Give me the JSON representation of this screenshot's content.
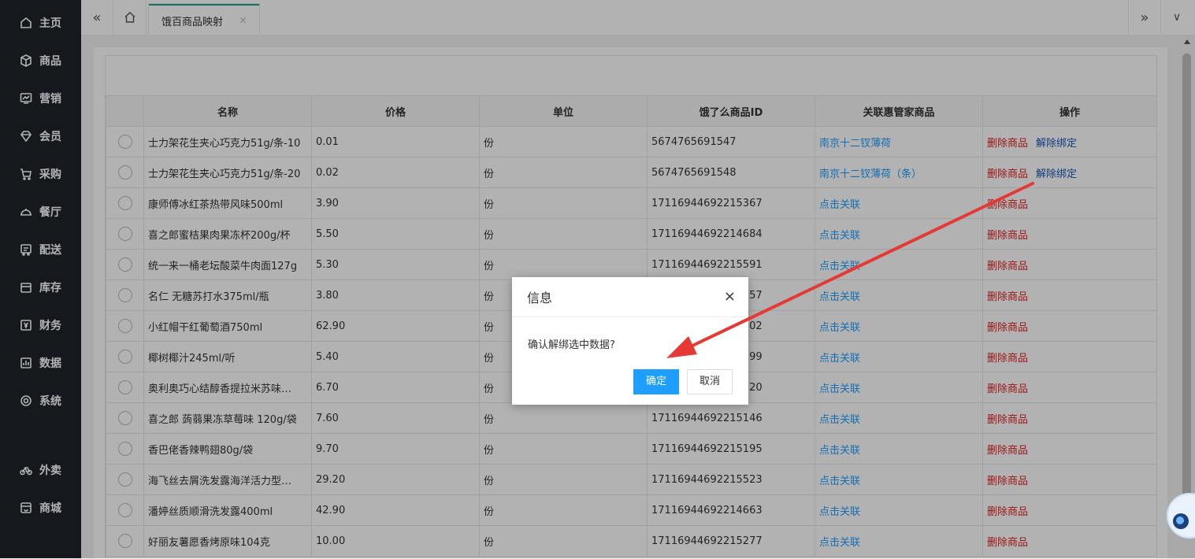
{
  "sidebar": {
    "items": [
      {
        "label": "主页",
        "icon": "home-icon"
      },
      {
        "label": "商品",
        "icon": "box-icon"
      },
      {
        "label": "营销",
        "icon": "chart-icon"
      },
      {
        "label": "会员",
        "icon": "diamond-icon"
      },
      {
        "label": "采购",
        "icon": "cart-icon"
      },
      {
        "label": "餐厅",
        "icon": "dish-icon"
      },
      {
        "label": "配送",
        "icon": "truck-icon"
      },
      {
        "label": "库存",
        "icon": "inventory-icon"
      },
      {
        "label": "财务",
        "icon": "yen-icon"
      },
      {
        "label": "数据",
        "icon": "bar-chart-icon"
      },
      {
        "label": "系统",
        "icon": "settings-icon"
      },
      {
        "label": "外卖",
        "icon": "bike-icon"
      },
      {
        "label": "商城",
        "icon": "store-icon"
      }
    ]
  },
  "tabbar": {
    "prev": "«",
    "next": "»",
    "menu": "∨",
    "active_tab": "饿百商品映射",
    "close": "×"
  },
  "table": {
    "headers": [
      "名称",
      "价格",
      "单位",
      "饿了么商品ID",
      "关联惠管家商品",
      "操作"
    ],
    "rows": [
      {
        "name": "士力架花生夹心巧克力51g/条-10",
        "price": "0.01",
        "unit": "份",
        "id": "5674765691547",
        "link": "南京十二钗薄荷",
        "op1": "删除商品",
        "op2": "解除绑定"
      },
      {
        "name": "士力架花生夹心巧克力51g/条-20",
        "price": "0.02",
        "unit": "份",
        "id": "5674765691548",
        "link": "南京十二钗薄荷（条）",
        "op1": "删除商品",
        "op2": "解除绑定"
      },
      {
        "name": "康师傅冰红茶热带风味500ml",
        "price": "3.90",
        "unit": "份",
        "id": "17116944692215367",
        "link": "点击关联",
        "op1": "删除商品",
        "op2": ""
      },
      {
        "name": "喜之郎蜜桔果肉果冻杯200g/杯",
        "price": "5.50",
        "unit": "份",
        "id": "17116944692214684",
        "link": "点击关联",
        "op1": "删除商品",
        "op2": ""
      },
      {
        "name": "统一来一桶老坛酸菜牛肉面127g",
        "price": "5.30",
        "unit": "份",
        "id": "17116944692215591",
        "link": "点击关联",
        "op1": "删除商品",
        "op2": ""
      },
      {
        "name": "名仁 无糖苏打水375ml/瓶",
        "price": "3.80",
        "unit": "份",
        "id": "17116944692215357",
        "link": "点击关联",
        "op1": "删除商品",
        "op2": ""
      },
      {
        "name": "小红帽干红葡萄酒750ml",
        "price": "62.90",
        "unit": "份",
        "id": "17116944692215402",
        "link": "点击关联",
        "op1": "删除商品",
        "op2": ""
      },
      {
        "name": "椰树椰汁245ml/听",
        "price": "5.40",
        "unit": "份",
        "id": "17116944692215399",
        "link": "点击关联",
        "op1": "删除商品",
        "op2": ""
      },
      {
        "name": "奥利奥巧心结醇香提拉米苏味…",
        "price": "6.70",
        "unit": "份",
        "id": "17116944692215420",
        "link": "点击关联",
        "op1": "删除商品",
        "op2": ""
      },
      {
        "name": "喜之郎 蒟蒻果冻草莓味 120g/袋",
        "price": "7.60",
        "unit": "份",
        "id": "17116944692215146",
        "link": "点击关联",
        "op1": "删除商品",
        "op2": ""
      },
      {
        "name": "香巴佬香辣鸭翅80g/袋",
        "price": "9.70",
        "unit": "份",
        "id": "17116944692215195",
        "link": "点击关联",
        "op1": "删除商品",
        "op2": ""
      },
      {
        "name": "海飞丝去屑洗发露海洋活力型…",
        "price": "29.20",
        "unit": "份",
        "id": "17116944692215523",
        "link": "点击关联",
        "op1": "删除商品",
        "op2": ""
      },
      {
        "name": "潘婷丝质顺滑洗发露400ml",
        "price": "42.90",
        "unit": "份",
        "id": "17116944692214663",
        "link": "点击关联",
        "op1": "删除商品",
        "op2": ""
      },
      {
        "name": "好丽友薯愿香烤原味104克",
        "price": "10.00",
        "unit": "份",
        "id": "17116944692215277",
        "link": "点击关联",
        "op1": "删除商品",
        "op2": ""
      }
    ]
  },
  "dialog": {
    "title": "信息",
    "close": "×",
    "message": "确认解绑选中数据?",
    "ok": "确定",
    "cancel": "取消"
  },
  "colors": {
    "sidebar_bg": "#1f2329",
    "tab_accent": "#1e9f91",
    "link_blue": "#1e9fff",
    "danger_red": "#e02020",
    "arrow_red": "#e53935"
  }
}
